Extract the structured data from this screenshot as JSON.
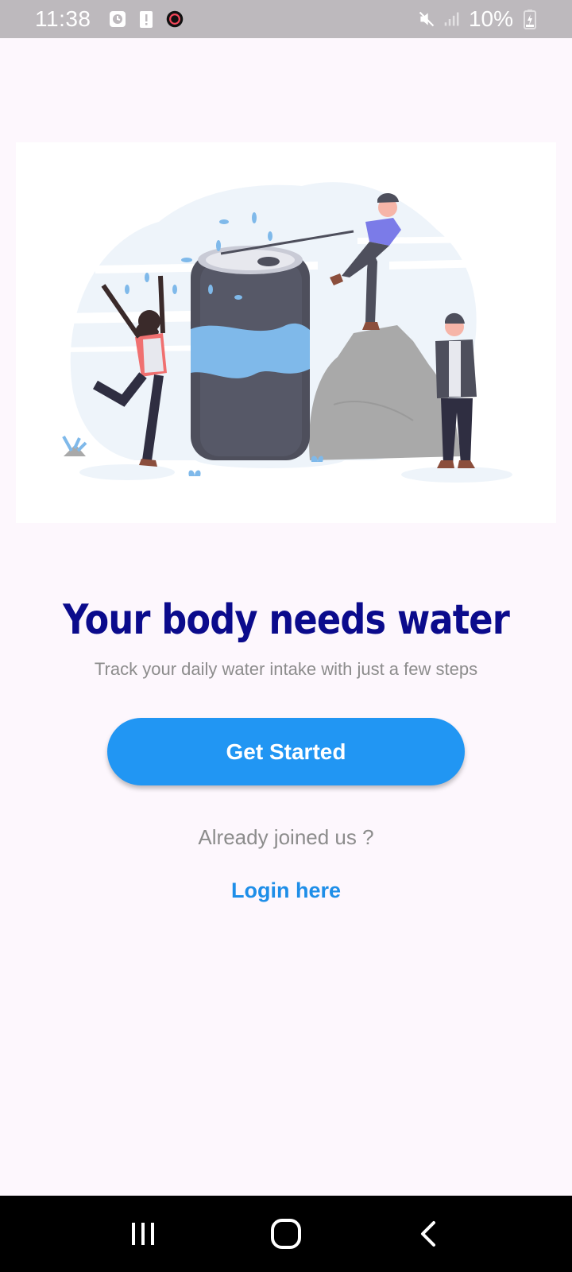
{
  "status_bar": {
    "time": "11:38",
    "battery_percent": "10%",
    "left_icons": [
      "alarm-icon",
      "battery-alert-icon",
      "record-icon"
    ],
    "right_icons": [
      "mute-icon",
      "signal-icon",
      "charging-battery-icon"
    ]
  },
  "illustration": {
    "name": "water-can-people-illustration",
    "accent_colors": {
      "water": "#7fb9ea",
      "can": "#4e4f5c",
      "rock": "#a9a9a9",
      "shirt_blue": "#7b7be8",
      "shirt_pink": "#f07070",
      "background_blob": "#eef4fa"
    }
  },
  "content": {
    "title": "Your body needs water",
    "subtitle": "Track your daily water intake with just a few steps",
    "cta_label": "Get Started",
    "already_text": "Already joined us ?",
    "login_label": "Login here"
  },
  "nav_bar": {
    "buttons": [
      "recent-apps-icon",
      "home-icon",
      "back-icon"
    ]
  },
  "colors": {
    "background": "#fdf7fd",
    "title": "#0b0b8c",
    "button": "#2196f3",
    "link": "#1e8ee8",
    "muted_text": "#8c8c8c",
    "status_bar": "#bdb9bd"
  }
}
